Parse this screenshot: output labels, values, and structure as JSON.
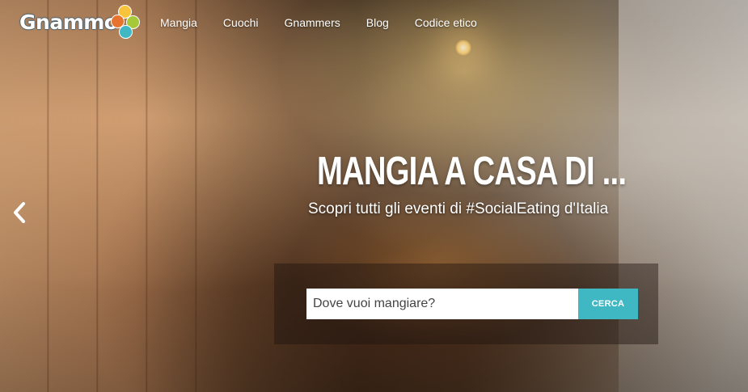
{
  "brand": {
    "logo_text": "Gnammo",
    "dot_colors": [
      "#f7c43b",
      "#a6c93a",
      "#3fb8c4",
      "#e8732f"
    ]
  },
  "nav": {
    "items": [
      {
        "label": "Mangia"
      },
      {
        "label": "Cuochi"
      },
      {
        "label": "Gnammers"
      },
      {
        "label": "Blog"
      },
      {
        "label": "Codice etico"
      }
    ]
  },
  "hero": {
    "headline": "MANGIA A CASA DI ...",
    "subheadline": "Scopri tutti gli eventi di #SocialEating d'Italia",
    "prev_icon": "chevron-left-icon"
  },
  "search": {
    "placeholder": "Dove vuoi mangiare?",
    "button_label": "CERCA",
    "button_color": "#3fb8c4"
  }
}
